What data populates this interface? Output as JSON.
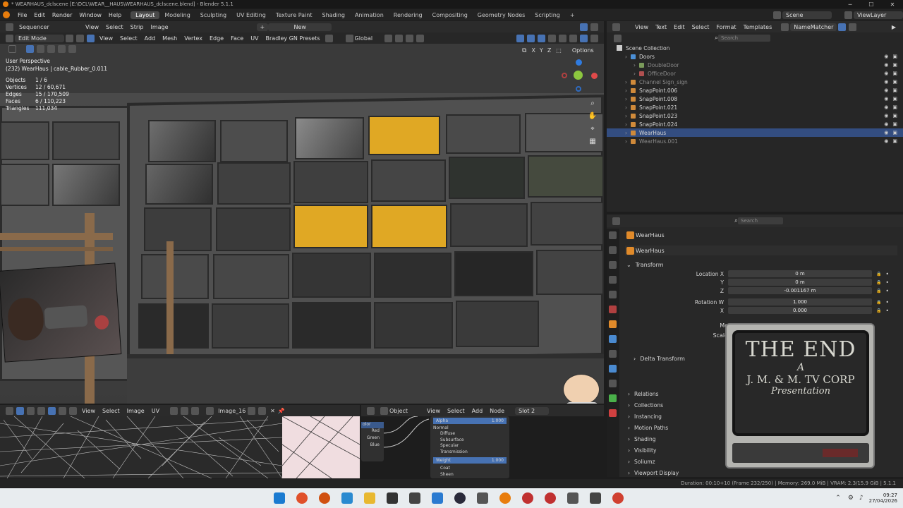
{
  "title_bar": {
    "title": "* WEARHAUS_dclscene [E:\\DCL\\WEAR__HAUS\\WEARHAUS_dclscene.blend] - Blender 5.1.1"
  },
  "top_menu": [
    "File",
    "Edit",
    "Render",
    "Window",
    "Help"
  ],
  "workspaces": [
    "Layout",
    "Modeling",
    "Sculpting",
    "UV Editing",
    "Texture Paint",
    "Shading",
    "Animation",
    "Rendering",
    "Compositing",
    "Geometry Nodes",
    "Scripting"
  ],
  "workspace_add": "+",
  "scene": {
    "label": "Scene",
    "view_layer": "ViewLayer"
  },
  "sequencer_header": {
    "editor": "Sequencer",
    "menus": [
      "View",
      "Select",
      "Strip",
      "Image"
    ],
    "new_label": "New",
    "plus": "+"
  },
  "viewport_header": {
    "mode": "Edit Mode",
    "menus": [
      "View",
      "Select",
      "Add",
      "Mesh",
      "Vertex",
      "Edge",
      "Face",
      "UV"
    ],
    "presets": "Bradley GN Presets",
    "orientation": "Global",
    "options": "Options",
    "xyz": [
      "X",
      "Y",
      "Z"
    ]
  },
  "viewport": {
    "view_name": "User Perspective",
    "object_line": "(232) WearHaus | cable_Rubber_0.011",
    "stats": [
      {
        "label": "Objects",
        "value": "1 / 6"
      },
      {
        "label": "Vertices",
        "value": "12 / 60,671"
      },
      {
        "label": "Edges",
        "value": "15 / 170,509"
      },
      {
        "label": "Faces",
        "value": "6 / 110,223"
      },
      {
        "label": "Triangles",
        "value": "111,034"
      }
    ]
  },
  "outliner": {
    "menus": [
      "View",
      "Text",
      "Edit",
      "Select",
      "Format",
      "Templates"
    ],
    "script_name": "NameMatcher",
    "search_placeholder": "Search",
    "root": "Scene Collection",
    "rows": [
      {
        "name": "Doors",
        "indent": 1,
        "color": "#4b8fd6"
      },
      {
        "name": "DoubleDoor",
        "indent": 2,
        "color": "#7a9a5a",
        "dim": true
      },
      {
        "name": "OfficeDoor",
        "indent": 2,
        "color": "#b05050",
        "dim": true
      },
      {
        "name": "Channel Sign_sign",
        "indent": 1,
        "color": "#d08a3a",
        "dim": true
      },
      {
        "name": "SnapPoint.006",
        "indent": 1,
        "color": "#d08a3a"
      },
      {
        "name": "SnapPoint.008",
        "indent": 1,
        "color": "#d08a3a"
      },
      {
        "name": "SnapPoint.021",
        "indent": 1,
        "color": "#d08a3a"
      },
      {
        "name": "SnapPoint.023",
        "indent": 1,
        "color": "#d08a3a"
      },
      {
        "name": "SnapPoint.024",
        "indent": 1,
        "color": "#d08a3a"
      },
      {
        "name": "WearHaus",
        "indent": 1,
        "color": "#d08a3a",
        "selected": true
      },
      {
        "name": "WearHaus.001",
        "indent": 1,
        "color": "#d08a3a",
        "dim": true
      }
    ]
  },
  "properties": {
    "search_placeholder": "Search",
    "object_name": "WearHaus",
    "data_name": "WearHaus",
    "transform_title": "Transform",
    "fields": [
      {
        "label": "Location X",
        "value": "0 m"
      },
      {
        "label": "Y",
        "value": "0 m"
      },
      {
        "label": "Z",
        "value": "-0.001167 m"
      },
      {
        "label": "Rotation W",
        "value": "1.000"
      },
      {
        "label": "X",
        "value": "0.000"
      }
    ],
    "partial_labels": [
      "Mo",
      "Scale"
    ],
    "delta": "Delta Transform",
    "panels": [
      "Relations",
      "Collections",
      "Instancing",
      "Motion Paths",
      "Shading",
      "Visibility",
      "Soliumz",
      "Viewport Display"
    ]
  },
  "tv_overlay": {
    "line1": "THE END",
    "line2": "A",
    "line3": "J. M. & M. TV CORP",
    "line4": "Presentation"
  },
  "image_editor": {
    "menus": [
      "View",
      "Select",
      "Image",
      "UV"
    ],
    "image_name": "Image_16"
  },
  "node_editor": {
    "type": "Object",
    "menus": [
      "View",
      "Select",
      "Add",
      "Node"
    ],
    "slot": "Slot 2",
    "sep_node": {
      "header": "olor",
      "rows": [
        "Red",
        "Green",
        "Blue"
      ]
    },
    "bsdf": {
      "alpha_label": "Alpha",
      "alpha_value": "1.000",
      "normal": "Normal",
      "sections": [
        "Diffuse",
        "Subsurface",
        "Specular",
        "Transmission"
      ],
      "weight_label": "Weight",
      "weight_value": "1.000",
      "sections2": [
        "Coat",
        "Sheen"
      ]
    }
  },
  "status_bar": {
    "text": "Duration: 00:10+10 (Frame 232/250) | Memory: 269.0 MiB | VRAM: 2.3/15.9 GiB | 5.1.1"
  },
  "taskbar": {
    "time": "09:27",
    "date": "27/04/2026"
  },
  "colors": {
    "selection": "#334d80",
    "accent": "#4772b3",
    "highlight_face": "#e0a824"
  }
}
